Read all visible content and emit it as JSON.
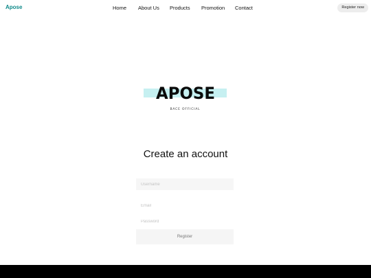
{
  "navbar": {
    "brand": "Apose",
    "links": [
      "Home",
      "About Us",
      "Products",
      "Promotion",
      "Contact"
    ],
    "cta": "Register now"
  },
  "logo": {
    "word": "APOSE",
    "tagline": "BACE OFFICIAL"
  },
  "form": {
    "title": "Create an account",
    "username_placeholder": "Username",
    "email_placeholder": "Email",
    "password_placeholder": "Password",
    "register_label": "Register"
  },
  "colors": {
    "brand": "#0f8a8a",
    "logo_band": "#c6f0f1",
    "footer": "#000000"
  }
}
